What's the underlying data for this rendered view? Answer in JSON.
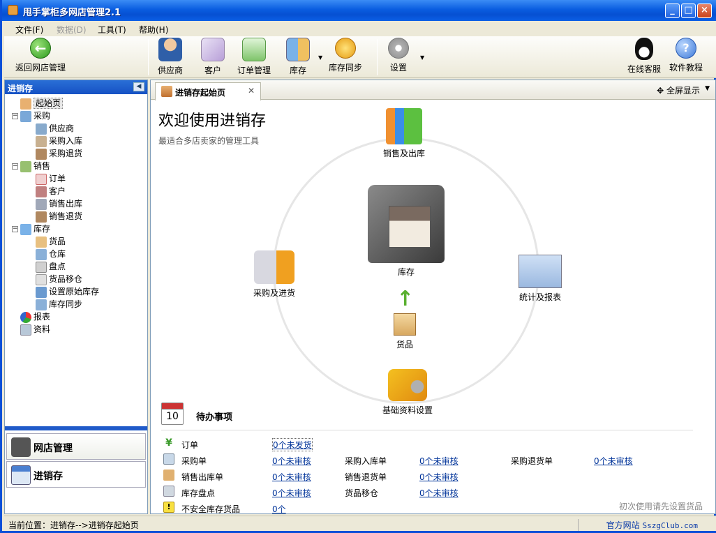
{
  "window": {
    "title": "甩手掌柜多网店管理2.1",
    "controls": [
      "minimize",
      "maximize",
      "close"
    ]
  },
  "menu": [
    {
      "label": "文件(F)",
      "enabled": true
    },
    {
      "label": "数据(D)",
      "enabled": false
    },
    {
      "label": "工具(T)",
      "enabled": true
    },
    {
      "label": "帮助(H)",
      "enabled": true
    }
  ],
  "toolbar": {
    "back_label": "返回网店管理",
    "supplier": "供应商",
    "customer": "客户",
    "orders": "订单管理",
    "inventory": "库存",
    "inv_sync": "库存同步",
    "settings": "设置",
    "support": "在线客服",
    "tutorial": "软件教程"
  },
  "sidebar": {
    "title": "进销存",
    "tree": {
      "home": "起始页",
      "purchase": "采购",
      "supplier": "供应商",
      "purchase_in": "采购入库",
      "purchase_return": "采购退货",
      "sales": "销售",
      "order": "订单",
      "customer": "客户",
      "sales_out": "销售出库",
      "sales_return": "销售退货",
      "stock": "库存",
      "goods": "货品",
      "warehouse": "仓库",
      "stocktake": "盘点",
      "goods_move": "货品移仓",
      "init_stock": "设置原始库存",
      "stock_sync": "库存同步",
      "report": "报表",
      "data": "资料"
    },
    "nav": {
      "shop": "网店管理",
      "erp": "进销存"
    }
  },
  "main": {
    "tab_label": "进销存起始页",
    "fullscreen": "全屏显示",
    "welcome": "欢迎使用进销存",
    "subtitle": "最适合多店卖家的管理工具",
    "diagram": {
      "sales_out": "销售及出库",
      "purchase": "采购及进货",
      "inventory": "库存",
      "report": "统计及报表",
      "goods": "货品",
      "basic": "基础资料设置"
    },
    "todo": {
      "title": "待办事项",
      "calendar_day": "10",
      "order": "订单",
      "order_link": "0个未发货",
      "po": "采购单",
      "po_link": "0个未审核",
      "pin": "采购入库单",
      "pin_link": "0个未审核",
      "pret": "采购退货单",
      "pret_link": "0个未审核",
      "sout": "销售出库单",
      "sout_link": "0个未审核",
      "sret": "销售退货单",
      "sret_link": "0个未审核",
      "take": "库存盘点",
      "take_link": "0个未审核",
      "move": "货品移仓",
      "move_link": "0个未审核",
      "unsafe": "不安全库存货品",
      "unsafe_link": "0个"
    },
    "hint": "初次使用请先设置货品"
  },
  "status": {
    "location": "当前位置：进销存-->进销存起始页",
    "site_label": "官方网站",
    "site_url": "SszgClub.com"
  }
}
